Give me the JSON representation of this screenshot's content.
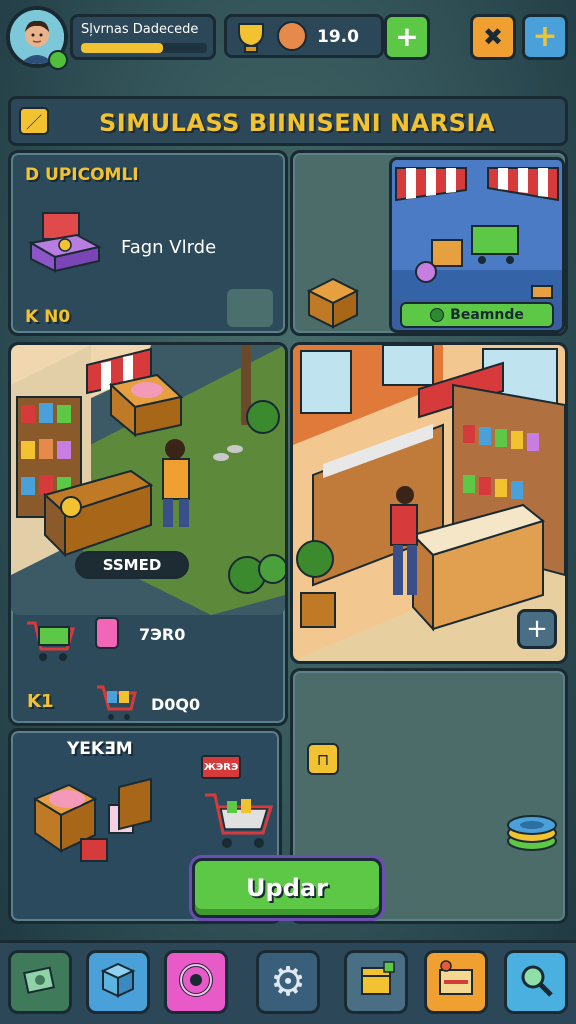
{
  "header": {
    "player_name": "Sļvrnas Dadecede",
    "xp_fraction": 0.65,
    "coins": "19.0"
  },
  "title_banner": {
    "text": "SIMULASS BIINISENI NARSIA"
  },
  "upgrades_panel": {
    "title": "D UPICOMLI",
    "item_label": "Fagn Vlrde",
    "footer": "K N0"
  },
  "store_preview": {
    "button_label": "Beamnde"
  },
  "shop_scene": {
    "badge": "SSMED",
    "stat_1": "7ЭR0",
    "stat_2": "D0Q0",
    "left_label": "K1"
  },
  "inventory_panel": {
    "title": "YEKƎM",
    "tag": "ЖЭRЭ"
  },
  "main_button": {
    "label": "Updar"
  },
  "colors": {
    "accent_yellow": "#f2c230",
    "accent_green": "#5cc845",
    "panel_border": "#1a2a33"
  },
  "bottom_nav": [
    {
      "icon": "cash-icon"
    },
    {
      "icon": "box-icon"
    },
    {
      "icon": "target-icon"
    },
    {
      "icon": "gear-icon"
    },
    {
      "icon": "crate-icon"
    },
    {
      "icon": "shop-icon"
    },
    {
      "icon": "magnifier-icon"
    }
  ]
}
